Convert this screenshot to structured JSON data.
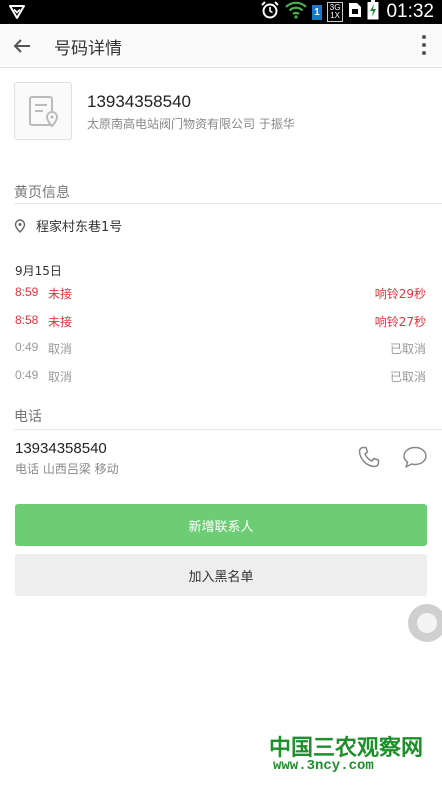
{
  "status_bar": {
    "time": "01:32",
    "badge": "1",
    "net_top": "3G",
    "net_bottom": "1X",
    "icons": [
      "notification-icon",
      "alarm-icon",
      "wifi-icon",
      "sim-icon",
      "battery-charging-icon"
    ]
  },
  "toolbar": {
    "title": "号码详情",
    "back_icon": "arrow-back-icon",
    "more_icon": "more-vert-icon"
  },
  "contact": {
    "number": "13934358540",
    "company": "太原南高电站阀门物资有限公司 于振华"
  },
  "yellow_pages": {
    "title": "黄页信息",
    "address": "程家村东巷1号"
  },
  "call_log": {
    "date": "9月15日",
    "entries": [
      {
        "time": "8:59",
        "type": "未接",
        "duration": "响铃29秒",
        "status": "missed"
      },
      {
        "time": "8:58",
        "type": "未接",
        "duration": "响铃27秒",
        "status": "missed"
      },
      {
        "time": "0:49",
        "type": "取消",
        "duration": "已取消",
        "status": "cancel"
      },
      {
        "time": "0:49",
        "type": "取消",
        "duration": "已取消",
        "status": "cancel"
      }
    ]
  },
  "phone_section": {
    "title": "电话",
    "number": "13934358540",
    "location": "电话 山西吕梁 移动"
  },
  "buttons": {
    "add_contact": "新增联系人",
    "add_blacklist": "加入黑名单"
  },
  "watermark": {
    "title": "中国三农观察网",
    "url": "www.3ncy.com"
  },
  "colors": {
    "accent_green": "#6ccd74",
    "missed_red": "#e5323c",
    "watermark_green": "#1f8f2b"
  }
}
